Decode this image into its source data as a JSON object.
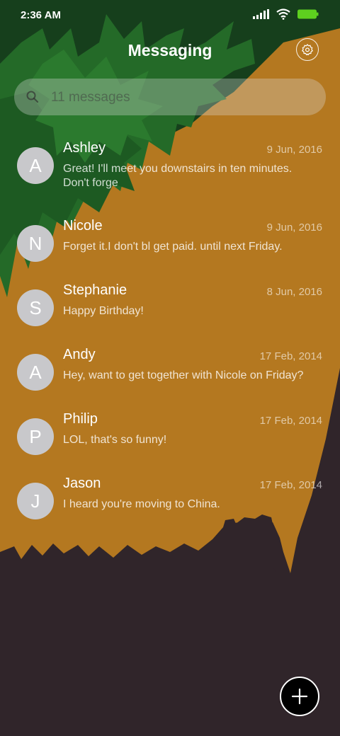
{
  "status_bar": {
    "time": "2:36 AM",
    "icons": [
      "signal-icon",
      "wifi-icon",
      "battery-icon"
    ],
    "battery_color": "#5ed01f"
  },
  "header": {
    "title": "Messaging",
    "settings_icon": "gear-icon"
  },
  "search": {
    "placeholder": "11 messages",
    "icon": "search-icon"
  },
  "conversations": [
    {
      "initial": "A",
      "name": "Ashley",
      "date": "9 Jun, 2016",
      "preview": "Great! I'll meet you downstairs in ten minutes. Don't forge"
    },
    {
      "initial": "N",
      "name": "Nicole",
      "date": "9 Jun, 2016",
      "preview": "Forget it.I don't bl get paid. until next Friday."
    },
    {
      "initial": "S",
      "name": "Stephanie",
      "date": "8 Jun, 2016",
      "preview": "Happy Birthday!"
    },
    {
      "initial": "A",
      "name": "Andy",
      "date": "17 Feb, 2014",
      "preview": "Hey, want to get together with Nicole on Friday?"
    },
    {
      "initial": "P",
      "name": "Philip",
      "date": "17 Feb, 2014",
      "preview": "LOL, that's so funny!"
    },
    {
      "initial": "J",
      "name": "Jason",
      "date": "17 Feb, 2014",
      "preview": "I heard you're moving to China."
    }
  ],
  "fab": {
    "icon": "plus-icon"
  },
  "colors": {
    "orange": "#b47820",
    "dark": "#30252a",
    "green_dark": "#174a1f",
    "green": "#256a2a",
    "avatar": "#c8c8cb"
  }
}
